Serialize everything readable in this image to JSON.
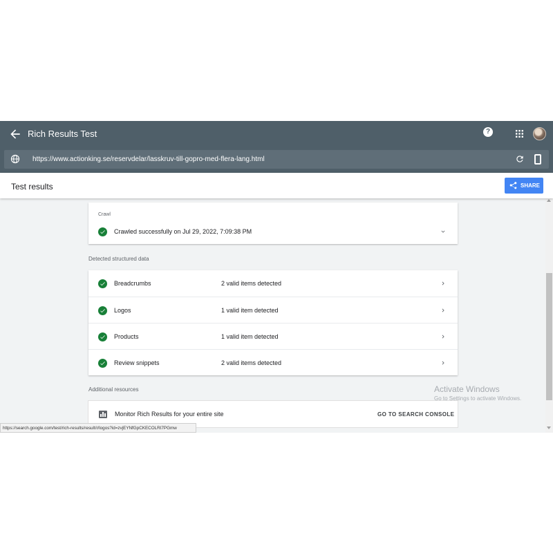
{
  "header": {
    "title": "Rich Results Test",
    "back_icon": "arrow-back-icon",
    "help_icon": "help-icon",
    "help_glyph": "?",
    "apps_icon": "apps-grid-icon",
    "avatar": "user-avatar",
    "bg_color": "#4f5f69"
  },
  "urlbar": {
    "url": "https://www.actionking.se/reservdelar/lasskruv-till-gopro-med-flera-lang.html",
    "globe_icon": "globe-icon",
    "reload_icon": "reload-icon",
    "device_icon": "smartphone-icon"
  },
  "results_bar": {
    "title": "Test results",
    "share_label": "SHARE",
    "share_icon": "share-icon",
    "share_color": "#4285f4"
  },
  "crawl": {
    "label": "Crawl",
    "status_text": "Crawled successfully on Jul 29, 2022, 7:09:38 PM",
    "status_icon": "check-circle-icon",
    "expand_icon": "chevron-down-icon"
  },
  "structured_data": {
    "heading": "Detected structured data",
    "items": [
      {
        "name": "Breadcrumbs",
        "count": "2 valid items detected"
      },
      {
        "name": "Logos",
        "count": "1 valid item detected"
      },
      {
        "name": "Products",
        "count": "1 valid item detected"
      },
      {
        "name": "Review snippets",
        "count": "2 valid items detected"
      }
    ],
    "valid_color": "#188038"
  },
  "additional_resources": {
    "heading": "Additional resources",
    "item_text": "Monitor Rich Results for your entire site",
    "item_icon": "bar-chart-icon",
    "link_label": "GO TO SEARCH CONSOLE"
  },
  "watermark": {
    "line1": "Activate Windows",
    "line2": "Go to Settings to activate Windows."
  },
  "status_url": "https://search.google.com/test/rich-results/result/r/logos?id=zvjEYNfGpCKECOLRI7PGmw"
}
